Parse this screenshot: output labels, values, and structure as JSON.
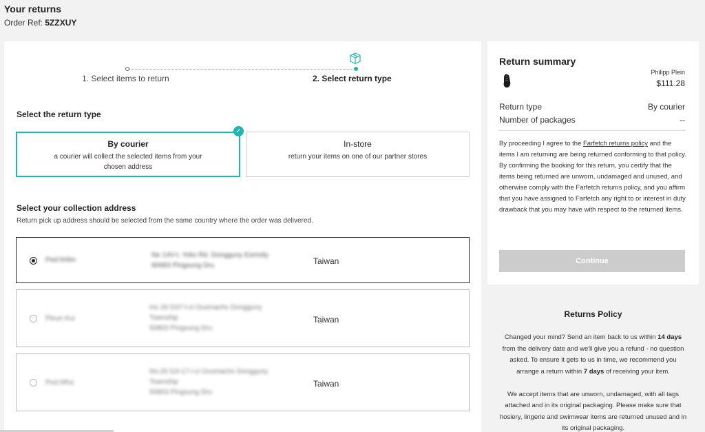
{
  "header": {
    "title": "Your returns",
    "order_ref_label": "Order Ref:",
    "order_ref_value": "5ZZXUY"
  },
  "stepper": {
    "step1": "1. Select items to return",
    "step2": "2. Select return type",
    "active_step": 2
  },
  "return_type": {
    "title": "Select the return type",
    "options": [
      {
        "title": "By courier",
        "desc": "a courier will collect the selected items from your chosen address",
        "selected": true
      },
      {
        "title": "In-store",
        "desc": "return your items on one of our partner stores",
        "selected": false
      }
    ]
  },
  "address": {
    "title": "Select your collection address",
    "help": "Return pick up address should be selected from the same country where the order was delivered.",
    "items": [
      {
        "name": "Ped.hHlm",
        "line1": "Ne 14V-t, Yokx Rd. Dongguny Esmsity",
        "line2": "60683 Pingsung Dru",
        "line3": "",
        "country": "Taiwan",
        "selected": true
      },
      {
        "name": "Pleun Kui",
        "line1": "ino 26 D37-l-ci Ousmachs Dongguny",
        "line2": "Township",
        "line3": "50803 Pingsung Dru",
        "country": "Taiwan",
        "selected": false
      },
      {
        "name": "Ped.hRui",
        "line1": "No.26 G3-17-i-ci Ousmachs Dongguny",
        "line2": "Township",
        "line3": "50803 Pingsung Dru",
        "country": "Taiwan",
        "selected": false
      }
    ]
  },
  "summary": {
    "title": "Return summary",
    "brand": "Philipp Plein",
    "price": "$111.28",
    "return_type_label": "Return type",
    "return_type_value": "By courier",
    "packages_label": "Number of packages",
    "packages_value": "--",
    "terms_p1_pre": "By proceeding I agree to the ",
    "terms_link": "Farfetch returns policy",
    "terms_p1_post": " and the items I am returning are being returned conforming to that policy.",
    "terms_p2": "By confirming the booking for this return, you certify that the items being returned are unworn, undamaged and unused, and otherwise comply with the Farfetch returns policy, and you affirm that you have assigned to Farfetch any right to or interest in duty drawback that you may have with respect to the returned items.",
    "continue_label": "Continue"
  },
  "policy": {
    "title": "Returns Policy",
    "p1_a": "Changed your mind? Send an item back to us within ",
    "p1_b": "14 days",
    "p1_c": " from the delivery date and we'll give you a refund - no question asked. To ensure it gets to us in time, we recommend you arrange a return within ",
    "p1_d": "7 days",
    "p1_e": " of receiving your item.",
    "p2": "We accept items that are unworn, undamaged, with all tags attached and in its original packaging. Please make sure that hosiery, lingerie and swimwear items are returned unused and in its original packaging."
  },
  "colors": {
    "accent": "#1fb7b4",
    "button_disabled": "#cccccc",
    "background": "#f2f2f2"
  },
  "icons": [
    "box-icon",
    "check-icon",
    "shoe-image",
    "radio-icon"
  ]
}
